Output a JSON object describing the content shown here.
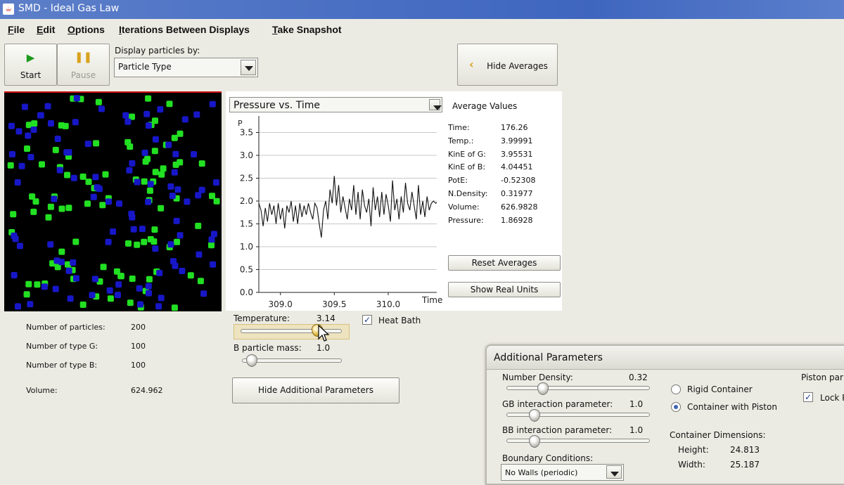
{
  "window": {
    "title": "SMD - Ideal Gas Law"
  },
  "menu": [
    {
      "mnemonic": "F",
      "rest": "ile"
    },
    {
      "mnemonic": "E",
      "rest": "dit"
    },
    {
      "mnemonic": "O",
      "rest": "ptions"
    },
    {
      "mnemonic": "I",
      "rest": "terations Between Displays"
    },
    {
      "mnemonic": "T",
      "rest": "ake Snapshot"
    }
  ],
  "toolbar": {
    "start_label": "Start",
    "pause_label": "Pause",
    "display_by_label": "Display particles by:",
    "display_by_value": "Particle Type",
    "hide_averages_label": "Hide Averages"
  },
  "chart_panel": {
    "selector_value": "Pressure vs. Time",
    "averages_title": "Average Values",
    "averages": [
      {
        "label": "Time:",
        "value": "176.26"
      },
      {
        "label": "Temp.:",
        "value": "3.99991"
      },
      {
        "label": "KinE of G:",
        "value": "3.95531"
      },
      {
        "label": "KinE of B:",
        "value": "4.04451"
      },
      {
        "label": "PotE:",
        "value": "-0.52308"
      },
      {
        "label": "N.Density:",
        "value": "0.31977"
      },
      {
        "label": "Volume:",
        "value": "626.9828"
      },
      {
        "label": "Pressure:",
        "value": "1.86928"
      }
    ],
    "reset_averages_label": "Reset Averages",
    "show_real_units_label": "Show Real Units"
  },
  "chart_data": {
    "type": "line",
    "ylabel": "P",
    "xlabel": "Time",
    "xlim": [
      308.8,
      310.45
    ],
    "ylim": [
      0,
      3.8
    ],
    "xticks": [
      "309.0",
      "309.5",
      "310.0"
    ],
    "yticks": [
      "0.0",
      "0.5",
      "1.0",
      "1.5",
      "2.0",
      "2.5",
      "3.0",
      "3.5"
    ],
    "grid": "horizontal",
    "series": [
      {
        "x": [
          308.8,
          308.82,
          308.84,
          308.86,
          308.88,
          308.9,
          308.92,
          308.94,
          308.96,
          308.98,
          309.0,
          309.02,
          309.04,
          309.06,
          309.08,
          309.1,
          309.12,
          309.14,
          309.16,
          309.18,
          309.2,
          309.22,
          309.24,
          309.26,
          309.28,
          309.3,
          309.32,
          309.34,
          309.36,
          309.38,
          309.4,
          309.42,
          309.44,
          309.46,
          309.48,
          309.5,
          309.52,
          309.54,
          309.56,
          309.58,
          309.6,
          309.62,
          309.64,
          309.66,
          309.68,
          309.7,
          309.72,
          309.74,
          309.76,
          309.78,
          309.8,
          309.82,
          309.84,
          309.86,
          309.88,
          309.9,
          309.92,
          309.94,
          309.96,
          309.98,
          310.0,
          310.02,
          310.04,
          310.06,
          310.08,
          310.1,
          310.12,
          310.14,
          310.16,
          310.18,
          310.2,
          310.22,
          310.24,
          310.26,
          310.28,
          310.3,
          310.32,
          310.34,
          310.36,
          310.38,
          310.4,
          310.42,
          310.44,
          310.45
        ],
        "y": [
          1.95,
          1.8,
          1.45,
          1.85,
          1.55,
          1.95,
          1.7,
          1.9,
          1.5,
          1.95,
          1.6,
          1.85,
          1.4,
          1.9,
          1.75,
          2.0,
          1.55,
          1.9,
          1.5,
          1.95,
          1.65,
          1.9,
          1.7,
          1.95,
          1.75,
          1.6,
          1.95,
          1.85,
          1.5,
          1.2,
          1.8,
          2.0,
          1.6,
          2.25,
          1.95,
          2.55,
          1.9,
          2.35,
          1.75,
          2.1,
          1.85,
          1.6,
          2.05,
          1.8,
          2.35,
          1.7,
          2.2,
          1.6,
          2.25,
          1.9,
          1.75,
          2.05,
          1.45,
          2.3,
          1.8,
          2.1,
          1.65,
          2.2,
          1.7,
          2.15,
          1.9,
          1.55,
          2.45,
          1.8,
          2.05,
          1.6,
          2.1,
          1.75,
          2.4,
          1.95,
          1.8,
          2.2,
          1.9,
          1.6,
          2.35,
          1.7,
          2.0,
          1.65,
          2.1,
          1.8,
          1.95,
          2.0,
          1.95,
          1.97
        ]
      }
    ]
  },
  "sim": {
    "green": "#22e022",
    "blue": "#1717c8",
    "background": "#000000"
  },
  "stats": [
    {
      "label": "Number of particles:",
      "value": "200"
    },
    {
      "label": "Number of type G:",
      "value": "100"
    },
    {
      "label": "Number of type B:",
      "value": "100"
    },
    {
      "label": "Volume:",
      "value": "624.962"
    }
  ],
  "controls": {
    "temperature_label": "Temperature:",
    "temperature_value": "3.14",
    "temperature_level": 0.79,
    "heat_bath_label": "Heat Bath",
    "b_mass_label": "B particle mass:",
    "b_mass_value": "1.0",
    "b_mass_level": 0.05,
    "hide_additional_label": "Hide Additional Parameters"
  },
  "additional": {
    "title": "Additional Parameters",
    "number_density_label": "Number Density:",
    "number_density_value": "0.32",
    "gb_label": "GB interaction parameter:",
    "gb_value": "1.0",
    "bb_label": "BB interaction parameter:",
    "bb_value": "1.0",
    "boundary_label": "Boundary Conditions:",
    "boundary_value": "No Walls (periodic)",
    "rigid_label": "Rigid Container",
    "piston_label": "Container with Piston",
    "container_dims_label": "Container Dimensions:",
    "height_label": "Height:",
    "height_value": "24.813",
    "width_label": "Width:",
    "width_value": "25.187",
    "piston_section_label": "Piston par",
    "lock_label": "Lock P"
  }
}
